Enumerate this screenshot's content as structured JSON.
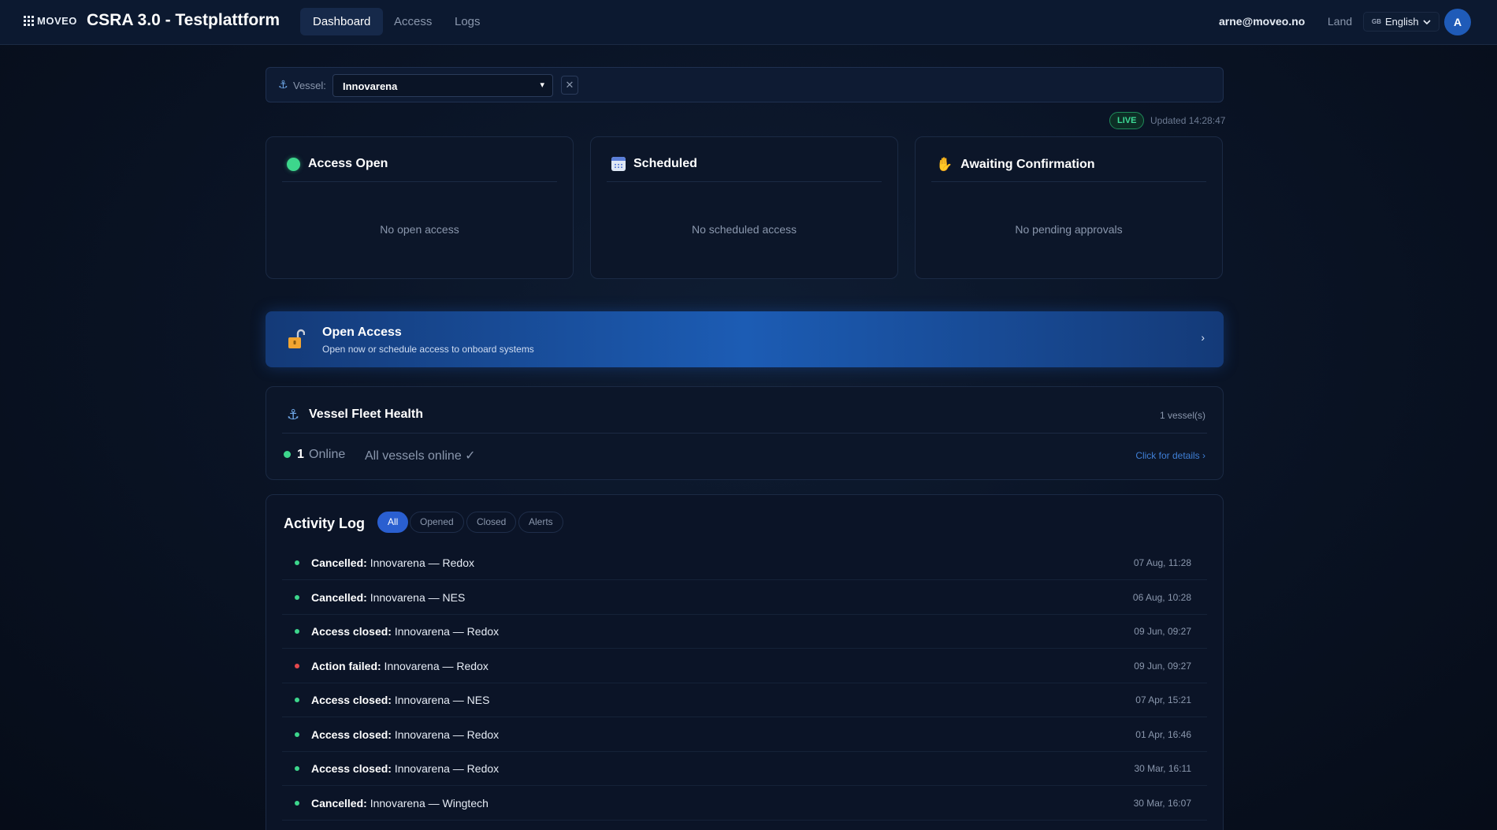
{
  "nav": {
    "logo_text": "MOVEO",
    "title": "CSRA 3.0 - Testplattform",
    "tabs": [
      "Dashboard",
      "Access",
      "Logs"
    ],
    "user_email": "arne@moveo.no",
    "land_label": "Land",
    "language": {
      "flag": "GB",
      "label": "English"
    },
    "avatar_initial": "A"
  },
  "vessel_filter": {
    "label": "Vessel:",
    "selected": "Innovarena"
  },
  "live": {
    "badge": "LIVE",
    "updated": "Updated 14:28:47"
  },
  "cards": [
    {
      "title": "Access Open",
      "icon": "green-dot-icon",
      "empty": "No open access"
    },
    {
      "title": "Scheduled",
      "icon": "calendar-icon",
      "empty": "No scheduled access"
    },
    {
      "title": "Awaiting Confirmation",
      "icon": "raised-hand-icon",
      "empty": "No pending approvals"
    }
  ],
  "open_access": {
    "title": "Open Access",
    "subtitle": "Open now or schedule access to onboard systems"
  },
  "fleet": {
    "title": "Vessel Fleet Health",
    "count": "1 vessel(s)",
    "online_count": "1",
    "online_label": "Online",
    "status": "All vessels online ✓",
    "details_link": "Click for details ›"
  },
  "activity": {
    "title": "Activity Log",
    "filters": [
      "All",
      "Opened",
      "Closed",
      "Alerts"
    ],
    "rows": [
      {
        "action": "Cancelled:",
        "detail": " Innovarena — Redox",
        "time": "07 Aug, 11:28",
        "status_color": "#3dd68c"
      },
      {
        "action": "Cancelled:",
        "detail": " Innovarena — NES",
        "time": "06 Aug, 10:28",
        "status_color": "#3dd68c"
      },
      {
        "action": "Access closed:",
        "detail": " Innovarena — Redox",
        "time": "09 Jun, 09:27",
        "status_color": "#3dd68c"
      },
      {
        "action": "Action failed:",
        "detail": " Innovarena — Redox",
        "time": "09 Jun, 09:27",
        "status_color": "#e5484d"
      },
      {
        "action": "Access closed:",
        "detail": " Innovarena — NES",
        "time": "07 Apr, 15:21",
        "status_color": "#3dd68c"
      },
      {
        "action": "Access closed:",
        "detail": " Innovarena — Redox",
        "time": "01 Apr, 16:46",
        "status_color": "#3dd68c"
      },
      {
        "action": "Access closed:",
        "detail": " Innovarena — Redox",
        "time": "30 Mar, 16:11",
        "status_color": "#3dd68c"
      },
      {
        "action": "Cancelled:",
        "detail": " Innovarena — Wingtech",
        "time": "30 Mar, 16:07",
        "status_color": "#3dd68c"
      }
    ]
  },
  "colors": {
    "accent": "#2a5fd0",
    "online": "#3dd68c",
    "error": "#e5484d",
    "live": "#3ddc97"
  }
}
